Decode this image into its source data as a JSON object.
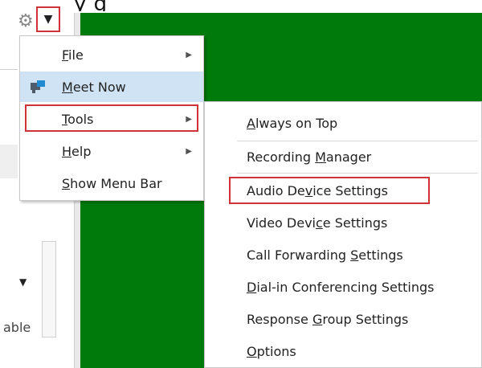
{
  "header": {
    "top_text": "y                                    g"
  },
  "left_pane": {
    "bottom_text": "able"
  },
  "main_menu": {
    "items": [
      {
        "label": "File",
        "underline_index": 0,
        "has_submenu": true
      },
      {
        "label": "Meet Now",
        "underline_index": 0,
        "has_submenu": false,
        "icon": "meet-now-icon"
      },
      {
        "label": "Tools",
        "underline_index": 0,
        "has_submenu": true
      },
      {
        "label": "Help",
        "underline_index": 0,
        "has_submenu": true
      },
      {
        "label": "Show Menu Bar",
        "underline_index": 0,
        "has_submenu": false
      }
    ]
  },
  "tools_submenu": {
    "items": [
      {
        "label": "Always on Top"
      },
      {
        "label": "Recording Manager"
      },
      {
        "label": "Audio Device Settings"
      },
      {
        "label": "Video Device Settings"
      },
      {
        "label": "Call Forwarding Settings"
      },
      {
        "label": "Dial-in Conferencing Settings"
      },
      {
        "label": "Response Group Settings"
      },
      {
        "label": "Options"
      }
    ]
  },
  "colors": {
    "highlight": "#cfe3f4",
    "callout_red": "#d0323a",
    "stage_green": "#007a0a"
  }
}
